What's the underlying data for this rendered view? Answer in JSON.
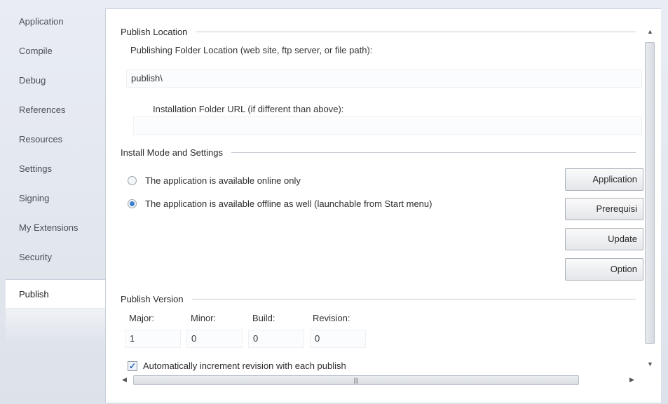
{
  "sidebar": {
    "items": [
      {
        "label": "Application"
      },
      {
        "label": "Compile"
      },
      {
        "label": "Debug"
      },
      {
        "label": "References"
      },
      {
        "label": "Resources"
      },
      {
        "label": "Settings"
      },
      {
        "label": "Signing"
      },
      {
        "label": "My Extensions"
      },
      {
        "label": "Security"
      },
      {
        "label": "Publish"
      }
    ],
    "selected": "Publish"
  },
  "publish_location": {
    "header": "Publish Location",
    "folder_label": "Publishing Folder Location (web site, ftp server, or file path):",
    "folder_value": "publish\\",
    "install_url_label": "Installation Folder URL (if different than above):",
    "install_url_value": ""
  },
  "install_mode": {
    "header": "Install Mode and Settings",
    "online_only_label": "The application is available online only",
    "offline_label": "The application is available offline as well (launchable from Start menu)",
    "selected": "offline",
    "buttons": {
      "application_files": "Application",
      "prerequisites": "Prerequisi",
      "updates": "Update",
      "options": "Option"
    }
  },
  "publish_version": {
    "header": "Publish Version",
    "major_label": "Major:",
    "minor_label": "Minor:",
    "build_label": "Build:",
    "revision_label": "Revision:",
    "major": "1",
    "minor": "0",
    "build": "0",
    "revision": "0",
    "auto_increment_label": "Automatically increment revision with each publish",
    "auto_increment_checked": true
  },
  "scrollbar": {
    "grip_glyph": "|||"
  }
}
